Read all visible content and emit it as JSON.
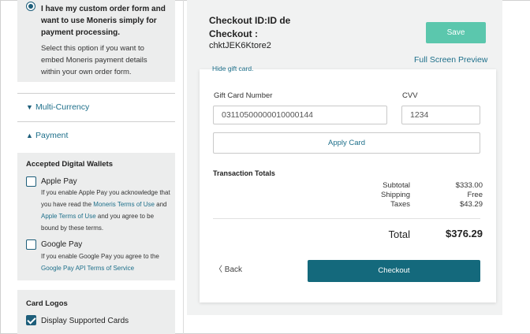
{
  "sidebar": {
    "custom_form": {
      "title": "I have my custom order form and want to use Moneris simply for payment processing.",
      "description": "Select this option if you want to embed Moneris payment details within your own order form."
    },
    "multi_currency_label": "Multi-Currency",
    "payment_label": "Payment",
    "digital_wallets": {
      "title": "Accepted Digital Wallets",
      "apple_pay": {
        "label": "Apple Pay",
        "desc_1": "If you enable Apple Pay you acknowledge that you have read the ",
        "link_1": "Moneris Terms of Use",
        "desc_2": " and ",
        "link_2": "Apple Terms of Use",
        "desc_3": " and you agree to be bound by these terms."
      },
      "google_pay": {
        "label": "Google Pay",
        "desc": "If you enable Google Pay you agree to the ",
        "link": "Google Pay API Terms of Service"
      }
    },
    "card_logos": {
      "title": "Card Logos",
      "display_supported_cards": "Display Supported Cards"
    }
  },
  "header": {
    "checkout_id_label": "Checkout ID:ID de Checkout :",
    "checkout_id_value": "chktJEK6Ktore2",
    "save_label": "Save",
    "full_screen_preview": "Full Screen Preview"
  },
  "card": {
    "hide_gift_card": "Hide gift card.",
    "gift_card_number_label": "Gift Card Number",
    "gift_card_number_value": "03110500000010000144",
    "cvv_label": "CVV",
    "cvv_value": "1234",
    "apply_card_label": "Apply Card",
    "transaction_totals_title": "Transaction Totals",
    "subtotal_label": "Subtotal",
    "subtotal_value": "$333.00",
    "shipping_label": "Shipping",
    "shipping_value": "Free",
    "taxes_label": "Taxes",
    "taxes_value": "$43.29",
    "total_label": "Total",
    "total_value": "$376.29",
    "back_label": "Back",
    "checkout_label": "Checkout"
  },
  "colors": {
    "accent": "#1d6f8a",
    "save_button": "#5bc7ad",
    "checkout_button": "#14697c"
  }
}
